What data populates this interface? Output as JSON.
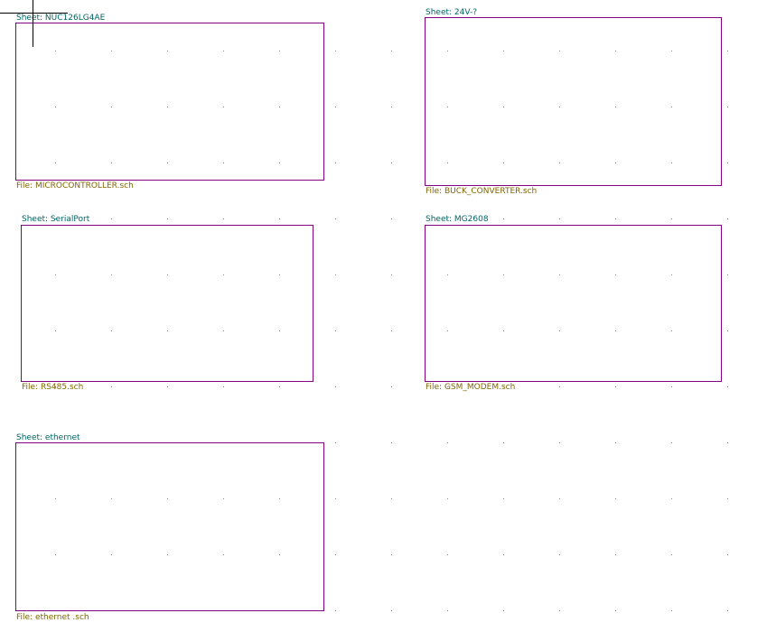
{
  "colors": {
    "background": "#ffffff",
    "grid_dot": "#8a8a8a",
    "sheet_border": "#840084",
    "sheet_name_text": "#006464",
    "sheet_file_text": "#806400",
    "cursor": "#000000"
  },
  "sheets": [
    {
      "name": "Sheet: NUC126LG4AE",
      "file": "File: MICROCONTROLLER.sch"
    },
    {
      "name": "Sheet: 24V-?",
      "file": "File: BUCK_CONVERTER.sch"
    },
    {
      "name": "Sheet: SerialPort",
      "file": "File: RS485.sch"
    },
    {
      "name": "Sheet: MG2608",
      "file": "File: GSM_MODEM.sch"
    },
    {
      "name": "Sheet: ethernet",
      "file": "File: ethernet .sch"
    }
  ]
}
